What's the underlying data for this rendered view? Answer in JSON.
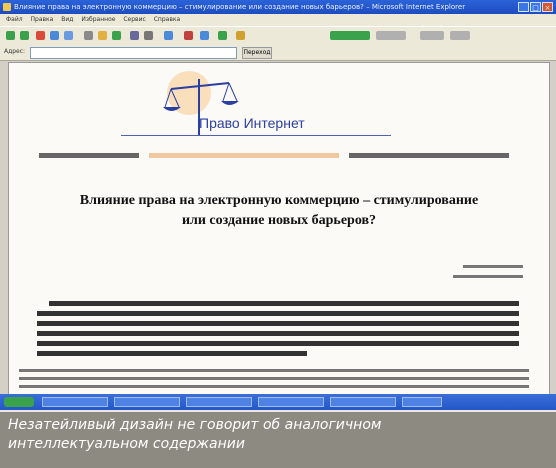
{
  "window": {
    "title": "Влияние права на электронную коммерцию – стимулирование или создание новых барьеров? – Microsoft Internet Explorer",
    "minimize_glyph": "_",
    "maximize_glyph": "□",
    "close_glyph": "×"
  },
  "menu": [
    "Файл",
    "Правка",
    "Вид",
    "Избранное",
    "Сервис",
    "Справка"
  ],
  "address": {
    "label": "Адрес:",
    "go_label": "Переход"
  },
  "page": {
    "logo_text": "Право Интернет",
    "title_line1": "Влияние права на электронную коммерцию – стимулирование",
    "title_line2": "или создание новых барьеров?"
  },
  "caption": {
    "line1": "Незатейливый дизайн не говорит об аналогичном",
    "line2": "интеллектуальном содержании"
  },
  "colors": {
    "titlebar": "#2c63d9",
    "logo_blue": "#2b3fa3",
    "logo_orange": "#f0a040",
    "caption_bg": "#8d8a82"
  }
}
